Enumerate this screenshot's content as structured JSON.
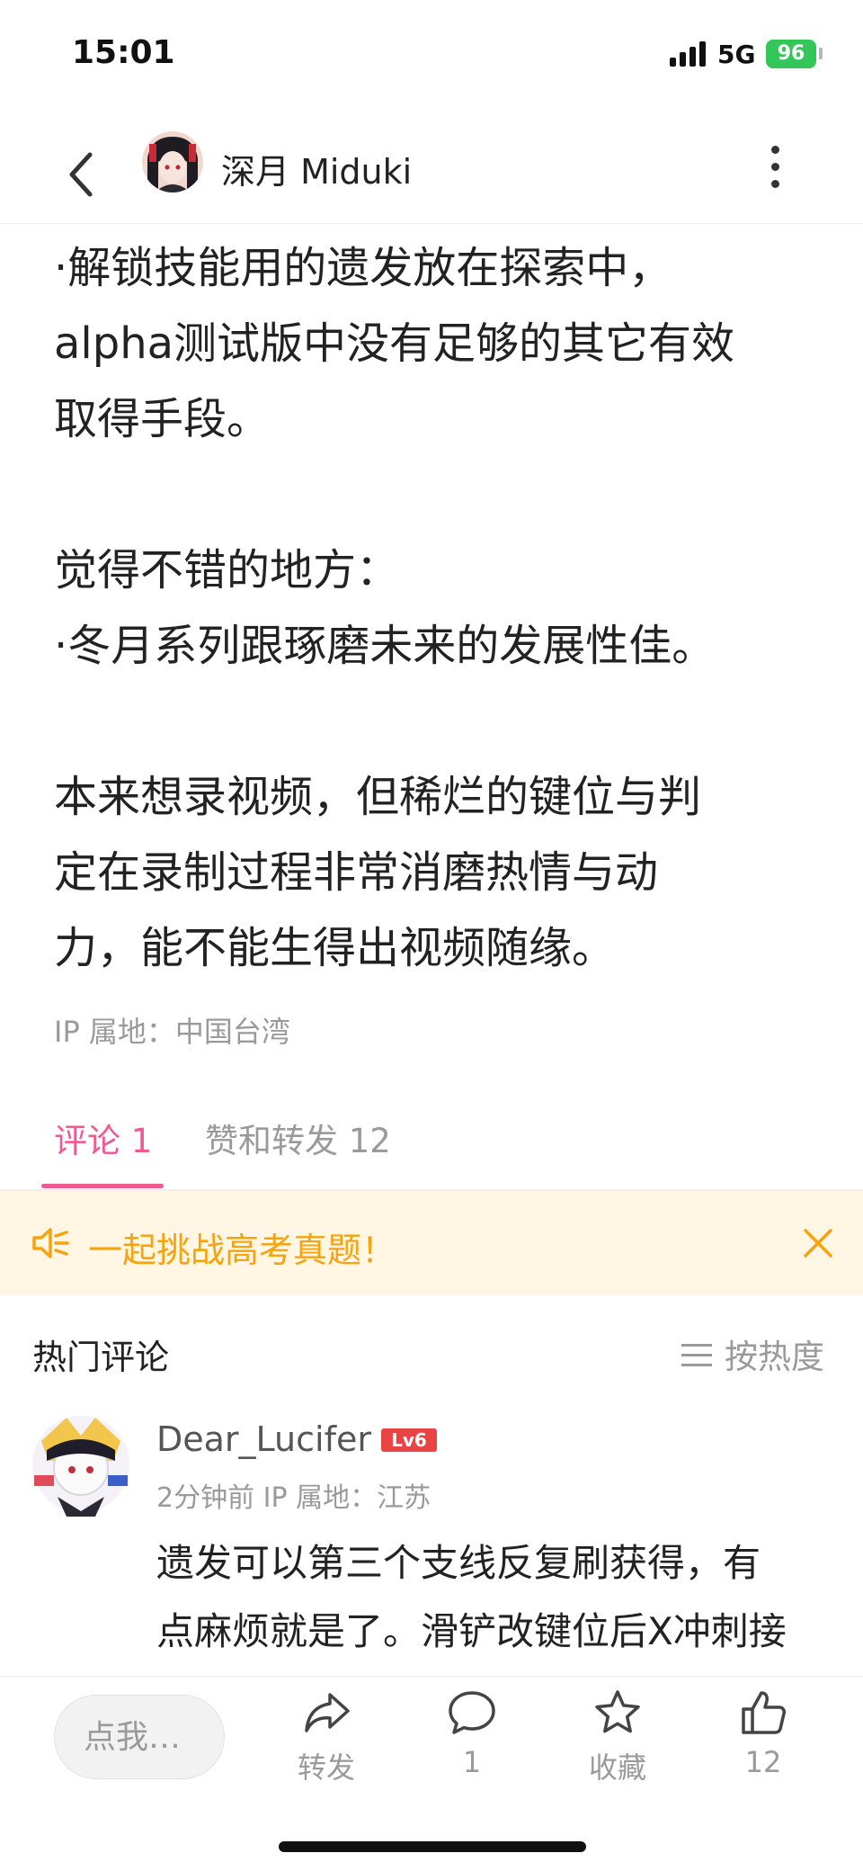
{
  "status_bar": {
    "time": "15:01",
    "network": "5G",
    "battery": "96",
    "battery_color": "#33c759"
  },
  "header": {
    "author_name": "深月 Miduki",
    "icons": [
      "back-icon",
      "author-avatar",
      "more-icon"
    ]
  },
  "post": {
    "lines": [
      "·解锁技能用的遗发放在探索中，",
      "alpha测试版中没有足够的其它有效",
      "取得手段。",
      "",
      "觉得不错的地方：",
      "·冬月系列跟琢磨未来的发展性佳。",
      "",
      "本来想录视频，但稀烂的键位与判",
      "定在录制过程非常消磨热情与动",
      "力，能不能生得出视频随缘。"
    ],
    "ip_location": "IP 属地：中国台湾"
  },
  "tabs": [
    {
      "label": "评论 1",
      "active": true
    },
    {
      "label": "赞和转发 12",
      "active": false
    }
  ],
  "accent_color": "#ef5a93",
  "notice": {
    "text": "一起挑战高考真题！",
    "color": "#f6a310",
    "icons": [
      "speaker-icon",
      "close-icon"
    ]
  },
  "comments_section": {
    "title": "热门评论",
    "sort_label": "按热度",
    "comments": [
      {
        "user": "Dear_Lucifer",
        "level": "Lv6",
        "meta": "2分钟前  IP 属地：江苏",
        "lines": [
          "遗发可以第三个支线反复刷获得，有",
          "点麻烦就是了。滑铲改键位后X冲刺接"
        ]
      }
    ]
  },
  "bottom_bar": {
    "reply_placeholder": "点我…",
    "actions": [
      {
        "icon": "share-icon",
        "label": "转发"
      },
      {
        "icon": "comment-icon",
        "label": "1"
      },
      {
        "icon": "star-icon",
        "label": "收藏"
      },
      {
        "icon": "thumbs-up-icon",
        "label": "12"
      }
    ]
  }
}
